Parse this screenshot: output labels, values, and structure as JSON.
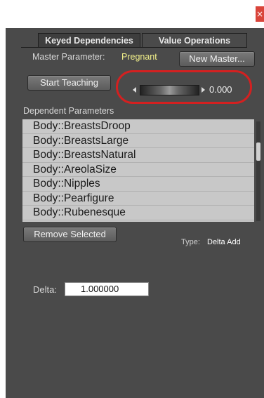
{
  "window": {
    "close_glyph": "×"
  },
  "tabs": [
    {
      "label": "Keyed Dependencies",
      "active": true
    },
    {
      "label": "Value Operations",
      "active": false
    }
  ],
  "master": {
    "label": "Master Parameter:",
    "value": "Pregnant",
    "new_master_button": "New Master..."
  },
  "teaching": {
    "start_button": "Start Teaching",
    "slider_value": "0.000"
  },
  "dependents": {
    "header": "Dependent Parameters",
    "items": [
      "Body::BreastsDroop",
      "Body::BreastsLarge",
      "Body::BreastsNatural",
      "Body::AreolaSize",
      "Body::Nipples",
      "Body::Pearfigure",
      "Body::Rubenesque"
    ],
    "remove_button": "Remove Selected",
    "type_label": "Type:",
    "type_value": "Delta Add"
  },
  "delta": {
    "label": "Delta:",
    "value": "1.000000"
  },
  "colors": {
    "panel_bg": "#4a4a4a",
    "highlight": "#d42020",
    "master_value": "#f2f08a"
  }
}
